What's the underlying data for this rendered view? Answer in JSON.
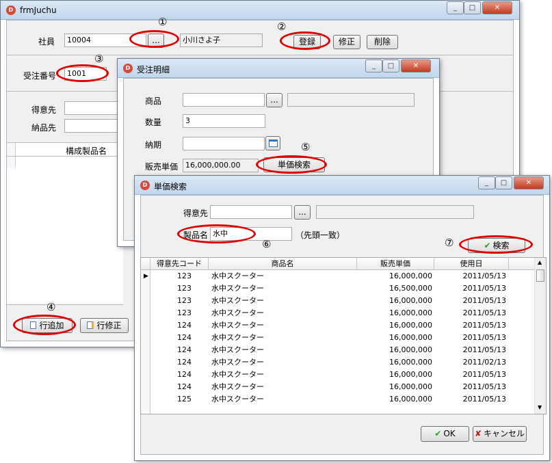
{
  "main_window": {
    "title": "frmJuchu",
    "employee_label": "社員",
    "employee_code": "10004",
    "ellipsis": "...",
    "employee_name": "小川さよ子",
    "register_label": "登録",
    "modify_label": "修正",
    "delete_label": "削除",
    "order_no_label": "受注番号",
    "order_no": "1001",
    "customer_label": "得意先",
    "delivery_label": "納品先",
    "grid_header": "構成製品名",
    "add_row_label": "行追加",
    "edit_row_label": "行修正"
  },
  "detail_window": {
    "title": "受注明細",
    "product_label": "商品",
    "ellipsis": "...",
    "quantity_label": "数量",
    "quantity": "3",
    "due_label": "納期",
    "price_label": "販売単価",
    "price": "16,000,000.00",
    "price_search_label": "単価検索"
  },
  "price_window": {
    "title": "単価検索",
    "customer_label": "得意先",
    "ellipsis": "...",
    "product_name_label": "製品名",
    "product_name": "水中",
    "prefix_match": "（先頭一致）",
    "search_label": "検索",
    "columns": [
      "得意先コード",
      "商品名",
      "販売単価",
      "使用日"
    ],
    "rows": [
      {
        "code": "123",
        "name": "水中スクーター",
        "price": "16,000,000",
        "date": "2011/05/13"
      },
      {
        "code": "123",
        "name": "水中スクーター",
        "price": "16,500,000",
        "date": "2011/05/13"
      },
      {
        "code": "123",
        "name": "水中スクーター",
        "price": "16,000,000",
        "date": "2011/05/13"
      },
      {
        "code": "123",
        "name": "水中スクーター",
        "price": "16,000,000",
        "date": "2011/05/13"
      },
      {
        "code": "124",
        "name": "水中スクーター",
        "price": "16,000,000",
        "date": "2011/05/13"
      },
      {
        "code": "124",
        "name": "水中スクーター",
        "price": "16,000,000",
        "date": "2011/05/13"
      },
      {
        "code": "124",
        "name": "水中スクーター",
        "price": "16,000,000",
        "date": "2011/05/13"
      },
      {
        "code": "124",
        "name": "水中スクーター",
        "price": "16,000,000",
        "date": "2011/02/13"
      },
      {
        "code": "124",
        "name": "水中スクーター",
        "price": "16,000,000",
        "date": "2011/05/13"
      },
      {
        "code": "124",
        "name": "水中スクーター",
        "price": "16,000,000",
        "date": "2011/05/13"
      },
      {
        "code": "125",
        "name": "水中スクーター",
        "price": "16,000,000",
        "date": "2011/05/13"
      }
    ],
    "ok_label": "OK",
    "cancel_label": "キャンセル"
  },
  "markers": {
    "m1": "①",
    "m2": "②",
    "m3": "③",
    "m4": "④",
    "m5": "⑤",
    "m6": "⑥",
    "m7": "⑦"
  },
  "colors": {
    "highlight": "#e00000",
    "title_bar": "#c2d6ec"
  }
}
